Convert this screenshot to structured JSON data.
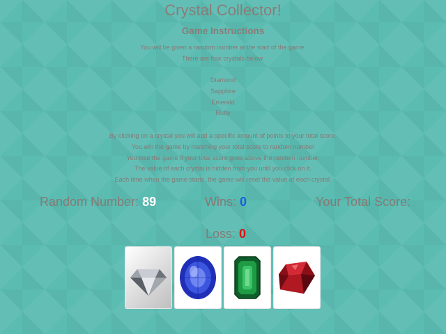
{
  "title": "Crystal Collector!",
  "instructions": {
    "heading": "Game Instructions",
    "intro": [
      "You will be given a random number at the start of the game.",
      "There are four crystals below."
    ],
    "crystals": [
      "Diamond",
      "Sapphire",
      "Emerald",
      "Ruby"
    ],
    "rules": [
      "By clicking on a crystal you will add a specific amount of points to your total score.",
      "You win the game by matching your total score to random number",
      "You lose the game if your total score goes above the random number.",
      "The value of each crystal is hidden from you until you click on it.",
      "Each time when the game starts, the game will reset the value of each crystal."
    ]
  },
  "stats": {
    "random_label": "Random Number:",
    "random_value": "89",
    "wins_label": "Wins:",
    "wins_value": "0",
    "score_label": "Your Total Score:",
    "score_value": "",
    "loss_label": "Loss:",
    "loss_value": "0"
  },
  "crystal_buttons": [
    {
      "icon": "diamond-icon",
      "color": "#9a9ea6"
    },
    {
      "icon": "sapphire-icon",
      "color": "#2e3fd0"
    },
    {
      "icon": "emerald-icon",
      "color": "#1f8a3d"
    },
    {
      "icon": "ruby-icon",
      "color": "#a3121c"
    }
  ]
}
